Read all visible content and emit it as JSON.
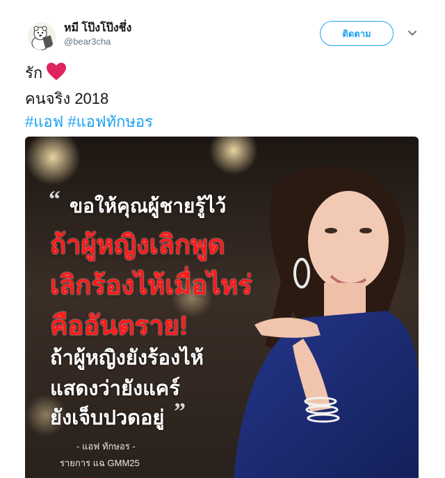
{
  "user": {
    "display_name": "หมี โป๊งโป๊งชึ่ง",
    "handle": "@bear3cha",
    "avatar_icon": "polar-bear-avatar-icon"
  },
  "follow_button": {
    "label": "ติดตาม"
  },
  "menu": {
    "icon": "chevron-down-icon"
  },
  "tweet": {
    "line1_text": "รัก",
    "line1_icon": "red-heart-icon",
    "line2_text": "คนจริง 2018",
    "hashtags": [
      "#แอฟ",
      "#แอฟทักษอร"
    ]
  },
  "media": {
    "quote_open": "“",
    "quote_close": "”",
    "lines": [
      "ขอให้คุณผู้ชายรู้ไว้",
      "ถ้าผู้หญิงเลิกพูด",
      "เลิกร้องไห้เมื่อไหร่",
      "คืออันตราย!",
      "ถ้าผู้หญิงยังร้องไห้",
      "แสดงว่ายังแคร์",
      "ยังเจ็บปวดอยู่"
    ],
    "credit_name": "- แอฟ ทักษอร -",
    "credit_show": "รายการ แฉ GMM25",
    "colors": {
      "highlight": "#ff1a1a",
      "dress": "#1b2a6b"
    }
  },
  "colors": {
    "accent": "#1da1f2",
    "text": "#14171a",
    "muted": "#657786"
  }
}
